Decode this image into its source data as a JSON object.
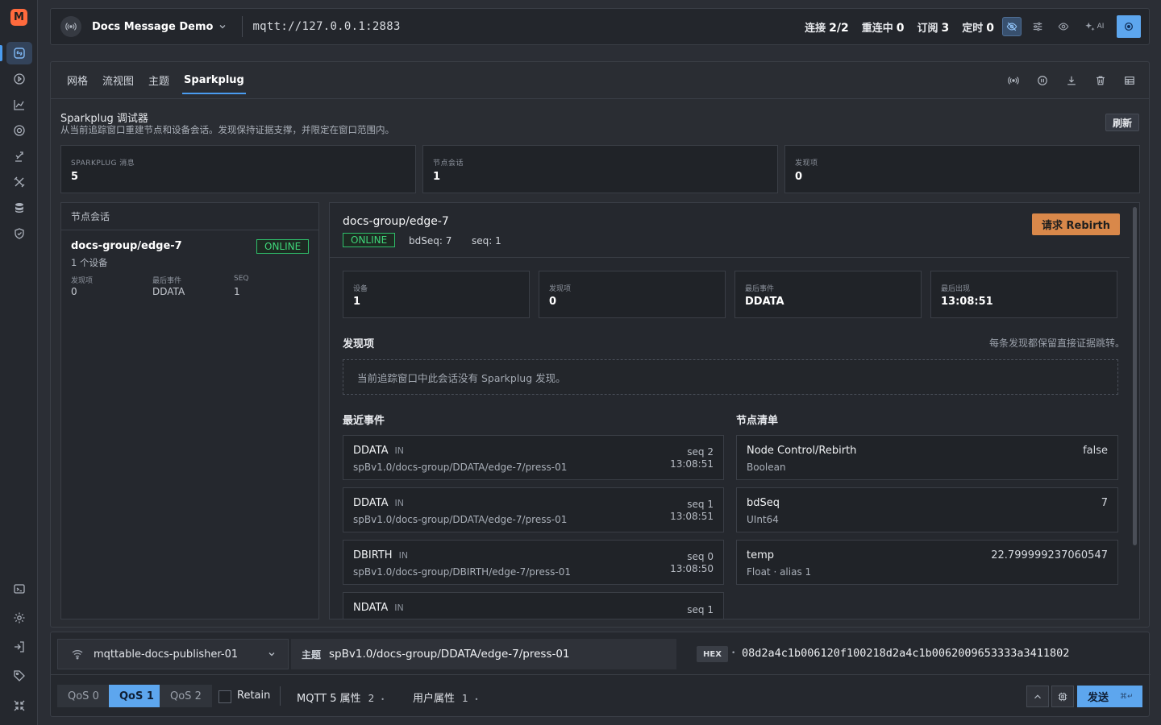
{
  "app": {
    "logo_letter": "M",
    "accent": "#4a9cf0",
    "warning": "#d9884a",
    "online": "#3fd67a"
  },
  "topbar": {
    "broker_name": "Docs Message Demo",
    "broker_url": "mqtt://127.0.0.1:2883",
    "stats": [
      {
        "label": "连接",
        "value": "2/2"
      },
      {
        "label": "重连中",
        "value": "0"
      },
      {
        "label": "订阅",
        "value": "3"
      },
      {
        "label": "定时",
        "value": "0"
      }
    ],
    "ai_label": "AI"
  },
  "tabs": [
    {
      "label": "网格",
      "active": false
    },
    {
      "label": "流视图",
      "active": false
    },
    {
      "label": "主题",
      "active": false
    },
    {
      "label": "Sparkplug",
      "active": true
    }
  ],
  "debugger": {
    "title": "Sparkplug 调试器",
    "subtitle": "从当前追踪窗口重建节点和设备会话。发现保持证据支撑，并限定在窗口范围内。",
    "refresh_label": "刷新",
    "kpis": [
      {
        "label": "SPARKPLUG 消息",
        "value": "5"
      },
      {
        "label": "节点会话",
        "value": "1"
      },
      {
        "label": "发现项",
        "value": "0"
      }
    ]
  },
  "sessions": {
    "header": "节点会话",
    "items": [
      {
        "name": "docs-group/edge-7",
        "status": "ONLINE",
        "devices": "1 个设备",
        "mini": [
          {
            "label": "发现项",
            "value": "0"
          },
          {
            "label": "最后事件",
            "value": "DDATA"
          },
          {
            "label": "SEQ",
            "value": "1"
          }
        ]
      }
    ]
  },
  "detail": {
    "name": "docs-group/edge-7",
    "status": "ONLINE",
    "bdseq": "bdSeq: 7",
    "seq": "seq: 1",
    "rebirth_label": "请求 Rebirth",
    "kpis": [
      {
        "label": "设备",
        "value": "1"
      },
      {
        "label": "发现项",
        "value": "0"
      },
      {
        "label": "最后事件",
        "value": "DDATA"
      },
      {
        "label": "最后出现",
        "value": "13:08:51"
      }
    ],
    "findings_title": "发现项",
    "findings_hint": "每条发现都保留直接证据跳转。",
    "findings_empty": "当前追踪窗口中此会话没有 Sparkplug 发现。",
    "events_title": "最近事件",
    "events": [
      {
        "type": "DDATA",
        "dir": "IN",
        "topic": "spBv1.0/docs-group/DDATA/edge-7/press-01",
        "seq": "seq 2",
        "time": "13:08:51"
      },
      {
        "type": "DDATA",
        "dir": "IN",
        "topic": "spBv1.0/docs-group/DDATA/edge-7/press-01",
        "seq": "seq 1",
        "time": "13:08:51"
      },
      {
        "type": "DBIRTH",
        "dir": "IN",
        "topic": "spBv1.0/docs-group/DBIRTH/edge-7/press-01",
        "seq": "seq 0",
        "time": "13:08:50"
      },
      {
        "type": "NDATA",
        "dir": "IN",
        "topic": "",
        "seq": "seq 1",
        "time": ""
      }
    ],
    "metrics_title": "节点清单",
    "metrics": [
      {
        "name": "Node Control/Rebirth",
        "type": "Boolean",
        "value": "false"
      },
      {
        "name": "bdSeq",
        "type": "UInt64",
        "value": "7"
      },
      {
        "name": "temp",
        "type": "Float · alias 1",
        "value": "22.799999237060547"
      }
    ]
  },
  "publisher": {
    "client": "mqttable-docs-publisher-01",
    "topic_label": "主题",
    "topic": "spBv1.0/docs-group/DDATA/edge-7/press-01",
    "format_tag": "HEX",
    "payload": "08d2a4c1b006120f100218d2a4c1b0062009653333a3411802",
    "qos": [
      {
        "label": "QoS 0",
        "active": false
      },
      {
        "label": "QoS 1",
        "active": true
      },
      {
        "label": "QoS 2",
        "active": false
      }
    ],
    "retain_label": "Retain",
    "mqtt5_label": "MQTT 5 属性",
    "mqtt5_count": "2",
    "user_props_label": "用户属性",
    "user_props_count": "1",
    "send_label": "发送",
    "send_shortcut": "⌘↵"
  }
}
